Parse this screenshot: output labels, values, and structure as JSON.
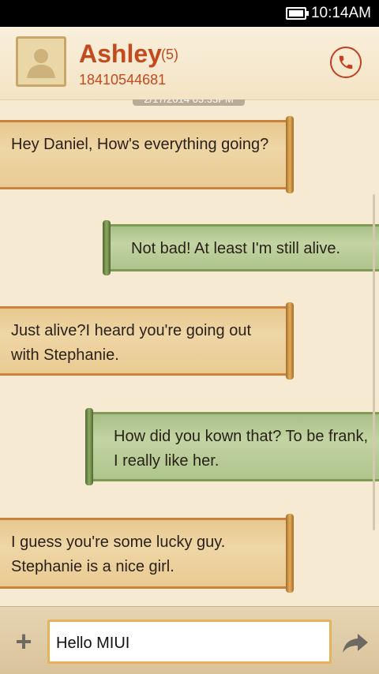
{
  "status_bar": {
    "time": "10:14AM"
  },
  "header": {
    "name": "Ashley",
    "count": "(5)",
    "phone": "18410544681"
  },
  "timestamp": "2/17/2014 03:33PM",
  "messages": [
    {
      "direction": "incoming",
      "text": "Hey Daniel, How's everything going?"
    },
    {
      "direction": "outgoing",
      "text": "Not bad! At least I'm still alive."
    },
    {
      "direction": "incoming",
      "text": "Just  alive?I heard you're going out with Stephanie."
    },
    {
      "direction": "outgoing",
      "text": "How did you kown that? To be frank, I really like her."
    },
    {
      "direction": "incoming",
      "text": "I guess you're some lucky guy. Stephanie is a nice girl."
    }
  ],
  "composer": {
    "value": "Hello MIUI"
  },
  "colors": {
    "accent": "#c34a1e",
    "incoming_bubble": "#efd6a6",
    "outgoing_bubble": "#c2d4a2"
  },
  "icons": [
    "battery-icon",
    "avatar-icon",
    "phone-icon",
    "add-icon",
    "send-icon"
  ]
}
